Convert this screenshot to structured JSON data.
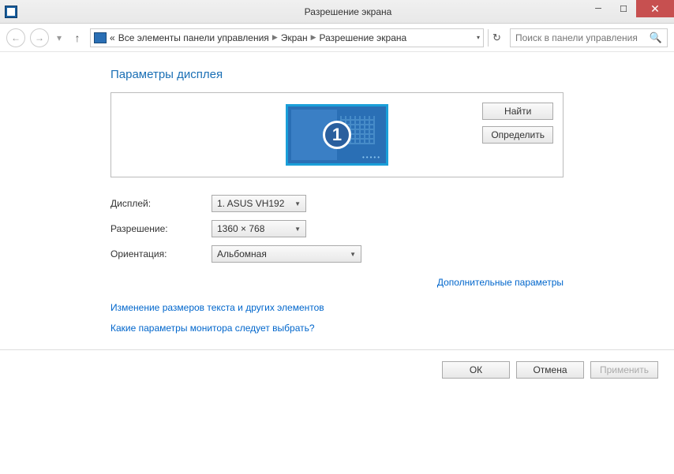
{
  "window": {
    "title": "Разрешение экрана"
  },
  "breadcrumb": {
    "prefix": "«",
    "item1": "Все элементы панели управления",
    "item2": "Экран",
    "item3": "Разрешение экрана"
  },
  "search": {
    "placeholder": "Поиск в панели управления"
  },
  "heading": "Параметры дисплея",
  "monitor_number": "1",
  "buttons": {
    "find": "Найти",
    "identify": "Определить"
  },
  "form": {
    "display_label": "Дисплей:",
    "display_value": "1. ASUS VH192",
    "resolution_label": "Разрешение:",
    "resolution_value": "1360 × 768",
    "orientation_label": "Ориентация:",
    "orientation_value": "Альбомная"
  },
  "links": {
    "advanced": "Дополнительные параметры",
    "textsize": "Изменение размеров текста и других элементов",
    "help": "Какие параметры монитора следует выбрать?"
  },
  "footer": {
    "ok": "ОК",
    "cancel": "Отмена",
    "apply": "Применить"
  }
}
